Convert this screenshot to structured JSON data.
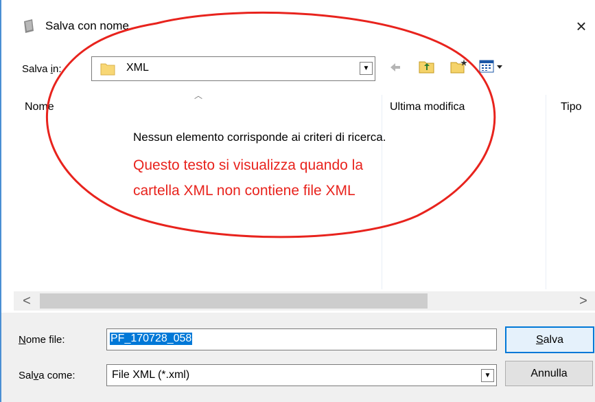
{
  "window": {
    "title": "Salva con nome",
    "close_symbol": "×"
  },
  "toolbar": {
    "save_in_label_pre": "Salva ",
    "save_in_label_ul": "i",
    "save_in_label_post": "n:",
    "location": "XML",
    "icons": [
      "back-arrow-icon",
      "up-folder-icon",
      "new-folder-icon",
      "view-menu-icon"
    ]
  },
  "file_list": {
    "columns": [
      "Nome",
      "Ultima modifica",
      "Tipo"
    ],
    "empty_message": "Nessun elemento corrisponde ai criteri di ricerca.",
    "annotation_lines": [
      "Questo testo si visualizza quando la",
      "cartella XML non contiene file XML"
    ]
  },
  "scrollbar": {
    "left_arrow": "<",
    "right_arrow": ">"
  },
  "form": {
    "filename_label_ul": "N",
    "filename_label_rest": "ome file:",
    "filename_value": "PF_170728_058",
    "savetype_label_pre": "Sal",
    "savetype_label_ul": "v",
    "savetype_label_post": "a come:",
    "savetype_value": "File XML (*.xml)"
  },
  "buttons": {
    "save_ul": "S",
    "save_rest": "alva",
    "cancel": "Annulla"
  },
  "colors": {
    "annotation": "#e8231d",
    "selection": "#0078d7"
  }
}
